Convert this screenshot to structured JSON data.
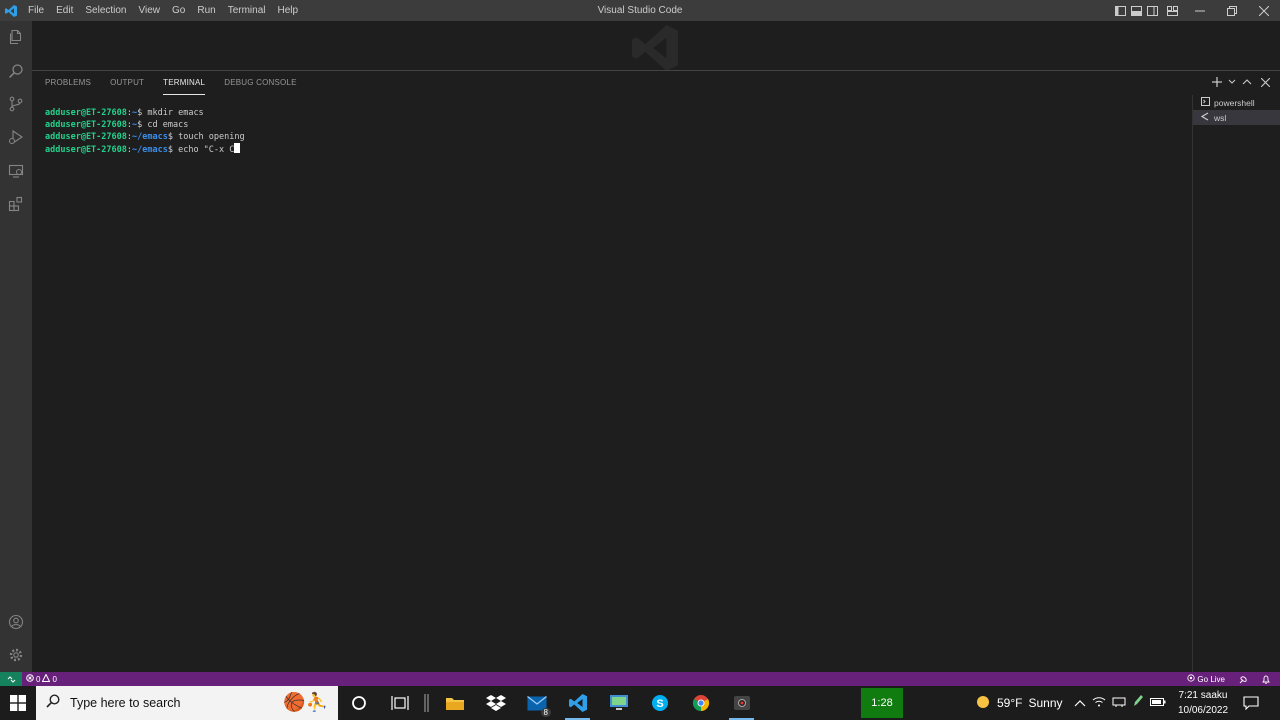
{
  "window": {
    "title": "Visual Studio Code",
    "menu": [
      "File",
      "Edit",
      "Selection",
      "View",
      "Go",
      "Run",
      "Terminal",
      "Help"
    ]
  },
  "panel": {
    "tabs": [
      {
        "label": "PROBLEMS",
        "active": false
      },
      {
        "label": "OUTPUT",
        "active": false
      },
      {
        "label": "TERMINAL",
        "active": true
      },
      {
        "label": "DEBUG CONSOLE",
        "active": false
      }
    ]
  },
  "terminal": {
    "lines": [
      {
        "user": "adduser@ET-27608",
        "sep": ":",
        "path": "~",
        "prompt": "$",
        "cmd": " mkdir emacs"
      },
      {
        "user": "adduser@ET-27608",
        "sep": ":",
        "path": "~",
        "prompt": "$",
        "cmd": " cd emacs"
      },
      {
        "user": "adduser@ET-27608",
        "sep": ":",
        "path": "~/emacs",
        "prompt": "$",
        "cmd": " touch opening"
      },
      {
        "user": "adduser@ET-27608",
        "sep": ":",
        "path": "~/emacs",
        "prompt": "$",
        "cmd": " echo \"C-x C"
      }
    ],
    "instances": [
      {
        "label": "powershell",
        "selected": false
      },
      {
        "label": "wsl",
        "selected": true
      }
    ]
  },
  "statusbar": {
    "errors": "0",
    "warnings": "0",
    "go_live": "Go Live"
  },
  "taskbar": {
    "search_placeholder": "Type here to search",
    "mail_badge": "8",
    "game_time": "1:28",
    "weather_temp": "59°F",
    "weather_desc": "Sunny",
    "time": "7:21 saaku",
    "date": "10/06/2022"
  },
  "colors": {
    "statusbar": "#68217a",
    "terminal_user": "#23d18b",
    "terminal_path": "#3b8eea",
    "accent": "#007acc"
  }
}
